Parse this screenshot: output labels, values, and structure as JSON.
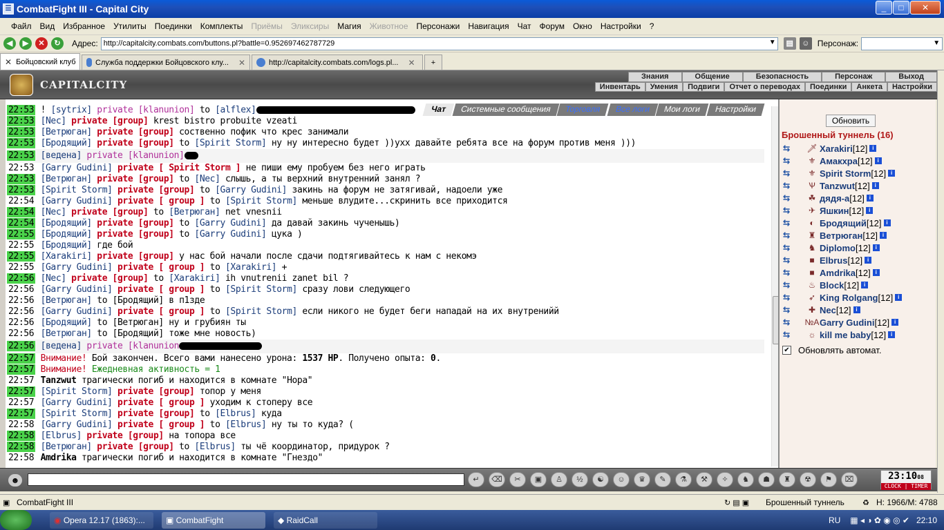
{
  "window": {
    "title": "CombatFight III - Capital City",
    "min": "_",
    "max": "□",
    "close": "✕"
  },
  "menu": [
    {
      "label": "Файл",
      "disabled": false
    },
    {
      "label": "Вид",
      "disabled": false
    },
    {
      "label": "Избранное",
      "disabled": false
    },
    {
      "label": "Утилиты",
      "disabled": false
    },
    {
      "label": "Поединки",
      "disabled": false
    },
    {
      "label": "Комплекты",
      "disabled": false
    },
    {
      "label": "Приёмы",
      "disabled": true
    },
    {
      "label": "Эликсиры",
      "disabled": true
    },
    {
      "label": "Магия",
      "disabled": false
    },
    {
      "label": "Животное",
      "disabled": true
    },
    {
      "label": "Персонажи",
      "disabled": false
    },
    {
      "label": "Навигация",
      "disabled": false
    },
    {
      "label": "Чат",
      "disabled": false
    },
    {
      "label": "Форум",
      "disabled": false
    },
    {
      "label": "Окно",
      "disabled": false
    },
    {
      "label": "Настройки",
      "disabled": false
    },
    {
      "label": "?",
      "disabled": false
    }
  ],
  "address": {
    "label": "Адрес:",
    "url": "http://capitalcity.combats.com/buttons.pl?battle=0.952697462787729",
    "persona_label": "Персонаж:",
    "persona_value": ""
  },
  "tabs": [
    {
      "label": "Бойцовский клуб",
      "close": ""
    },
    {
      "label": "Служба поддержки Бойцовского клу...",
      "close": "✕"
    },
    {
      "label": "http://capitalcity.combats.com/logs.pl...",
      "close": "✕"
    }
  ],
  "new_tab": "+",
  "header": {
    "logo": "CAPITALCITY",
    "top_buttons": [
      "Знания",
      "Общение",
      "Безопасность",
      "Персонаж",
      "Выход"
    ],
    "bottom_buttons": [
      "Инвентарь",
      "Умения",
      "Подвиги",
      "Отчет о переводах",
      "Поединки",
      "Анкета",
      "Настройки"
    ]
  },
  "chat_tabs": [
    {
      "label": "Чат",
      "kind": "active"
    },
    {
      "label": "Системные сообщения",
      "kind": "normal"
    },
    {
      "label": "Торговля",
      "kind": "link"
    },
    {
      "label": "Все логи",
      "kind": "link"
    },
    {
      "label": "Мои логи",
      "kind": "normal"
    },
    {
      "label": "Настройки",
      "kind": "normal"
    }
  ],
  "chat": [
    {
      "t": "22:53",
      "g": true,
      "parts": [
        [
          "!",
          ""
        ],
        [
          " [sytrix] ",
          "nm"
        ],
        [
          "private [klanunion]",
          "pvk"
        ],
        [
          " to ",
          ""
        ],
        [
          "[alflex]",
          "nm"
        ]
      ],
      "blk": 230
    },
    {
      "t": "22:53",
      "g": true,
      "parts": [
        [
          "[Nec] ",
          "nm"
        ],
        [
          "private [group]",
          "pv"
        ],
        [
          " krest bistro probuite vzeati",
          ""
        ]
      ]
    },
    {
      "t": "22:53",
      "g": true,
      "parts": [
        [
          "[Ветрюган] ",
          "nm"
        ],
        [
          "private [group]",
          "pv"
        ],
        [
          " соственно пофик что крес занимали",
          ""
        ]
      ]
    },
    {
      "t": "22:53",
      "g": true,
      "parts": [
        [
          "[Бродящий] ",
          "nm"
        ],
        [
          "private [group]",
          "pv"
        ],
        [
          " to ",
          ""
        ],
        [
          "[Spirit Storm]",
          "nm"
        ],
        [
          " ну ну интересно будет ))ухх давайте ребята все на форум против меня )))",
          ""
        ]
      ]
    },
    {
      "t": "22:53",
      "g": true,
      "hl": true,
      "parts": [
        [
          "[ведена] ",
          "nm"
        ],
        [
          "private [klanunion]",
          "pvk"
        ]
      ],
      "blk": 20
    },
    {
      "t": "22:53",
      "g": false,
      "parts": [
        [
          "[Garry Gudini] ",
          "nm"
        ],
        [
          "private [ Spirit Storm ]",
          "pv"
        ],
        [
          " не пиши ему пробуем без него играть",
          ""
        ]
      ]
    },
    {
      "t": "22:53",
      "g": true,
      "parts": [
        [
          "[Ветрюган] ",
          "nm"
        ],
        [
          "private [group]",
          "pv"
        ],
        [
          " to ",
          ""
        ],
        [
          "[Nec]",
          "nm"
        ],
        [
          " слышь, а ты верхний внутренний занял ?",
          ""
        ]
      ]
    },
    {
      "t": "22:53",
      "g": true,
      "parts": [
        [
          "[Spirit Storm] ",
          "nm"
        ],
        [
          "private [group]",
          "pv"
        ],
        [
          " to ",
          ""
        ],
        [
          "[Garry Gudini]",
          "nm"
        ],
        [
          " закинь на форум не затягивай, надоели уже",
          ""
        ]
      ]
    },
    {
      "t": "22:54",
      "g": false,
      "parts": [
        [
          "[Garry Gudini] ",
          "nm"
        ],
        [
          "private [ group ]",
          "pv"
        ],
        [
          " to ",
          ""
        ],
        [
          "[Spirit Storm]",
          "nm"
        ],
        [
          " меньше влудите...скринить все приходится",
          ""
        ]
      ]
    },
    {
      "t": "22:54",
      "g": true,
      "parts": [
        [
          "[Nec] ",
          "nm"
        ],
        [
          "private [group]",
          "pv"
        ],
        [
          " to ",
          ""
        ],
        [
          "[Ветрюган]",
          "nm"
        ],
        [
          " net vnesnii",
          ""
        ]
      ]
    },
    {
      "t": "22:54",
      "g": true,
      "parts": [
        [
          "[Бродящий] ",
          "nm"
        ],
        [
          "private [group]",
          "pv"
        ],
        [
          " to ",
          ""
        ],
        [
          "[Garry Gudini]",
          "nm"
        ],
        [
          " да давай закинь чученышь)",
          ""
        ]
      ]
    },
    {
      "t": "22:55",
      "g": true,
      "parts": [
        [
          "[Бродящий] ",
          "nm"
        ],
        [
          "private [group]",
          "pv"
        ],
        [
          " to ",
          ""
        ],
        [
          "[Garry Gudini]",
          "nm"
        ],
        [
          " цука )",
          ""
        ]
      ]
    },
    {
      "t": "22:55",
      "g": false,
      "parts": [
        [
          "[Бродящий]",
          "nm"
        ],
        [
          " где бой",
          ""
        ]
      ]
    },
    {
      "t": "22:55",
      "g": true,
      "parts": [
        [
          "[Xarakiri] ",
          "nm"
        ],
        [
          "private [group]",
          "pv"
        ],
        [
          " у нас бой начали после сдачи подтягивайтесь к нам с некомэ",
          ""
        ]
      ]
    },
    {
      "t": "22:55",
      "g": false,
      "parts": [
        [
          "[Garry Gudini] ",
          "nm"
        ],
        [
          "private [ group ]",
          "pv"
        ],
        [
          " to ",
          ""
        ],
        [
          "[Xarakiri]",
          "nm"
        ],
        [
          " +",
          ""
        ]
      ]
    },
    {
      "t": "22:56",
      "g": true,
      "parts": [
        [
          "[Nec] ",
          "nm"
        ],
        [
          "private [group]",
          "pv"
        ],
        [
          " to ",
          ""
        ],
        [
          "[Xarakiri]",
          "nm"
        ],
        [
          " ih vnutrenii zanet bil ?",
          ""
        ]
      ]
    },
    {
      "t": "22:56",
      "g": false,
      "parts": [
        [
          "[Garry Gudini] ",
          "nm"
        ],
        [
          "private [ group ]",
          "pv"
        ],
        [
          " to ",
          ""
        ],
        [
          "[Spirit Storm]",
          "nm"
        ],
        [
          " сразу лови следующего",
          ""
        ]
      ]
    },
    {
      "t": "22:56",
      "g": false,
      "parts": [
        [
          "[Ветрюган]",
          "nm"
        ],
        [
          " to [Бродящий] в п1зде",
          ""
        ]
      ]
    },
    {
      "t": "22:56",
      "g": false,
      "parts": [
        [
          "[Garry Gudini] ",
          "nm"
        ],
        [
          "private [ group ]",
          "pv"
        ],
        [
          " to ",
          ""
        ],
        [
          "[Spirit Storm]",
          "nm"
        ],
        [
          " если никого не будет беги нападай на их внутренийй",
          ""
        ]
      ]
    },
    {
      "t": "22:56",
      "g": false,
      "parts": [
        [
          "[Бродящий]",
          "nm"
        ],
        [
          " to [Ветрюган] ну и грубиян ты",
          ""
        ]
      ]
    },
    {
      "t": "22:56",
      "g": false,
      "parts": [
        [
          "[Ветрюган]",
          "nm"
        ],
        [
          " to [Бродящий] тоже мне новость)",
          ""
        ]
      ]
    },
    {
      "t": "22:56",
      "g": true,
      "hl": true,
      "parts": [
        [
          "[ведена] ",
          "nm"
        ],
        [
          "private [klanunion",
          "pvk"
        ]
      ],
      "blk": 120
    },
    {
      "t": "22:57",
      "g": true,
      "parts": [
        [
          "Внимание!",
          "warn"
        ],
        [
          " Бой закончен. Всего вами нанесено урона: ",
          ""
        ],
        [
          "1537 HP",
          "b"
        ],
        [
          ". Получено опыта: ",
          ""
        ],
        [
          "0",
          "b"
        ],
        [
          ".",
          ""
        ]
      ]
    },
    {
      "t": "22:57",
      "g": true,
      "parts": [
        [
          "Внимание!",
          "warn"
        ],
        [
          " Ежедневная активность = 1",
          "grn"
        ]
      ]
    },
    {
      "t": "22:57",
      "g": false,
      "parts": [
        [
          "Tanzwut",
          "b"
        ],
        [
          " трагически погиб и находится в комнате \"Нора\"",
          ""
        ]
      ]
    },
    {
      "t": "22:57",
      "g": true,
      "parts": [
        [
          "[Spirit Storm] ",
          "nm"
        ],
        [
          "private [group]",
          "pv"
        ],
        [
          " топор у меня",
          ""
        ]
      ]
    },
    {
      "t": "22:57",
      "g": false,
      "parts": [
        [
          "[Garry Gudini] ",
          "nm"
        ],
        [
          "private [ group ]",
          "pv"
        ],
        [
          " уходим к стоперу все",
          ""
        ]
      ]
    },
    {
      "t": "22:57",
      "g": true,
      "parts": [
        [
          "[Spirit Storm] ",
          "nm"
        ],
        [
          "private [group]",
          "pv"
        ],
        [
          " to ",
          ""
        ],
        [
          "[Elbrus]",
          "nm"
        ],
        [
          " куда",
          ""
        ]
      ]
    },
    {
      "t": "22:58",
      "g": false,
      "parts": [
        [
          "[Garry Gudini] ",
          "nm"
        ],
        [
          "private [ group ]",
          "pv"
        ],
        [
          " to ",
          ""
        ],
        [
          "[Elbrus]",
          "nm"
        ],
        [
          " ну ты то куда? (",
          ""
        ]
      ]
    },
    {
      "t": "22:58",
      "g": true,
      "parts": [
        [
          "[Elbrus] ",
          "nm"
        ],
        [
          "private [group]",
          "pv"
        ],
        [
          " на топора все",
          ""
        ]
      ]
    },
    {
      "t": "22:58",
      "g": true,
      "parts": [
        [
          "[Ветрюган] ",
          "nm"
        ],
        [
          "private [group]",
          "pv"
        ],
        [
          " to ",
          ""
        ],
        [
          "[Elbrus]",
          "nm"
        ],
        [
          " ты чё координатор, придурок ?",
          ""
        ]
      ]
    },
    {
      "t": "22:58",
      "g": false,
      "parts": [
        [
          "Amdrika",
          "b"
        ],
        [
          " трагически погиб и находится в комнате \"Гнездо\"",
          ""
        ]
      ]
    }
  ],
  "sidebar": {
    "refresh": "Обновить",
    "location": "Брошенный туннель (16)",
    "people": [
      {
        "name": "Xarakiri",
        "level": "[12]",
        "icon": "🗡"
      },
      {
        "name": "Амакхра",
        "level": "[12]",
        "icon": "⚜"
      },
      {
        "name": "Spirit Storm",
        "level": "[12]",
        "icon": "⚜"
      },
      {
        "name": "Tanzwut",
        "level": "[12]",
        "icon": "Ѱ"
      },
      {
        "name": "дядя-а",
        "level": "[12]",
        "icon": "☘"
      },
      {
        "name": "Яшкин",
        "level": "[12]",
        "icon": "✈"
      },
      {
        "name": "Бродящий",
        "level": "[12]",
        "icon": "◐"
      },
      {
        "name": "Ветрюган",
        "level": "[12]",
        "icon": "♜"
      },
      {
        "name": "Diplomo",
        "level": "[12]",
        "icon": "♞"
      },
      {
        "name": "Elbrus",
        "level": "[12]",
        "icon": "■"
      },
      {
        "name": "Amdrika",
        "level": "[12]",
        "icon": "■"
      },
      {
        "name": "Block",
        "level": "[12]",
        "icon": "♨"
      },
      {
        "name": "King Rolgang",
        "level": "[12]",
        "icon": "➶"
      },
      {
        "name": "Nec",
        "level": "[12]",
        "icon": "✚"
      },
      {
        "name": "Garry Gudini",
        "level": "[12]",
        "icon": "№A"
      },
      {
        "name": "kill me baby",
        "level": "[12]",
        "icon": "☼"
      }
    ],
    "auto_update": "Обновлять автомат."
  },
  "clock": {
    "time": "23:10",
    "seconds": "08",
    "label": "CLOCK | TIMER"
  },
  "statusbar": {
    "title": "CombatFight III",
    "location": "Брошенный туннель",
    "hp": "H: 1966/M: 4788"
  },
  "taskbar": {
    "items": [
      {
        "label": "Opera 12.17 (1863):...",
        "active": false
      },
      {
        "label": "CombatFight",
        "active": true
      },
      {
        "label": "RaidCall",
        "active": false
      }
    ],
    "lang": "RU",
    "time": "22:10"
  },
  "colors": {
    "timestamp_bg": "#4ad24a",
    "private": "#c0001a",
    "klanunion": "#b0309a",
    "nick": "#1a3c7a",
    "location": "#b01818"
  }
}
